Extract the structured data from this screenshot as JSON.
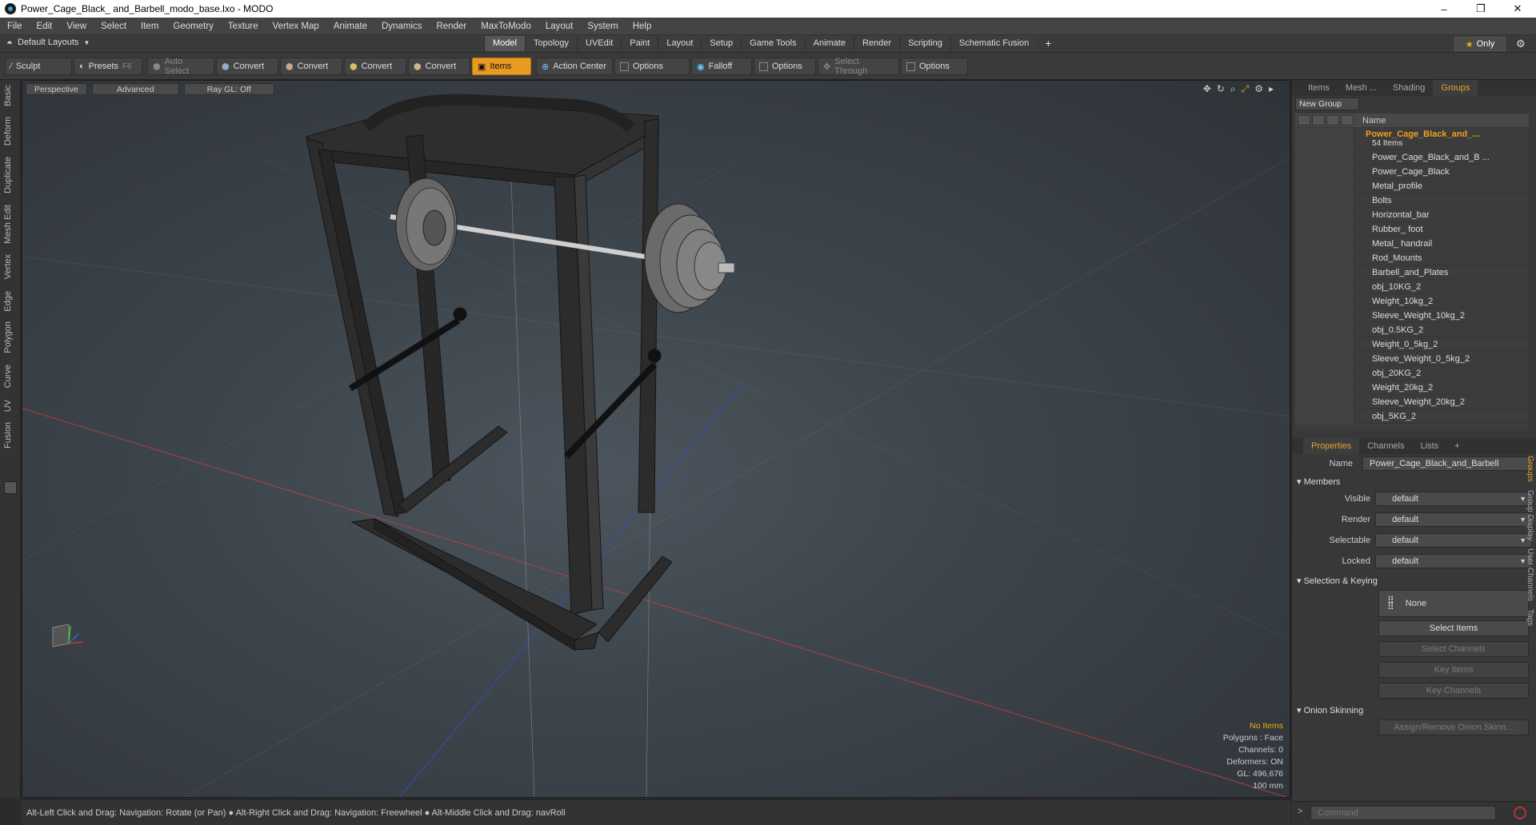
{
  "window": {
    "title": "Power_Cage_Black_ and_Barbell_modo_base.lxo - MODO",
    "min": "–",
    "restore": "❐",
    "close": "✕"
  },
  "menu": [
    "File",
    "Edit",
    "View",
    "Select",
    "Item",
    "Geometry",
    "Texture",
    "Vertex Map",
    "Animate",
    "Dynamics",
    "Render",
    "MaxToModo",
    "Layout",
    "System",
    "Help"
  ],
  "layoutbar": {
    "layout_label": "Default Layouts",
    "tabs": [
      "Model",
      "Topology",
      "UVEdit",
      "Paint",
      "Layout",
      "Setup",
      "Game Tools",
      "Animate",
      "Render",
      "Scripting",
      "Schematic Fusion"
    ],
    "active_tab": "Model",
    "add": "+",
    "only_label": "Only"
  },
  "toolbar": {
    "sculpt": "Sculpt",
    "presets": "Presets",
    "presets_key": "F6",
    "auto_select": "Auto Select",
    "convert1": "Convert",
    "convert2": "Convert",
    "convert3": "Convert",
    "convert4": "Convert",
    "items": "Items",
    "action_center": "Action Center",
    "options1": "Options",
    "falloff": "Falloff",
    "options2": "Options",
    "select_through": "Select Through",
    "options3": "Options"
  },
  "left_tabs": [
    "Basic",
    "Deform",
    "Duplicate",
    "Mesh Edit",
    "Vertex",
    "Edge",
    "Polygon",
    "Curve",
    "UV",
    "Fusion"
  ],
  "viewport": {
    "view": "Perspective",
    "mode": "Advanced",
    "raygl": "Ray GL: Off",
    "stats": {
      "no_items": "No Items",
      "polygons": "Polygons : Face",
      "channels": "Channels: 0",
      "deformers": "Deformers: ON",
      "gl": "GL: 496,676",
      "scale": "100 mm"
    }
  },
  "status": "Alt-Left Click and Drag: Navigation: Rotate (or Pan) ● Alt-Right Click and Drag: Navigation: Freewheel ● Alt-Middle Click and Drag: navRoll",
  "panel_top": {
    "tabs": [
      "Items",
      "Mesh ...",
      "Shading",
      "Groups"
    ],
    "active": "Groups",
    "new_group": "New Group",
    "name_col": "Name",
    "root": "Power_Cage_Black_and_...",
    "root_count": "54 Items",
    "items": [
      "Power_Cage_Black_and_B ...",
      "Power_Cage_Black",
      "Metal_profile",
      "Bolts",
      "Horizontal_bar",
      "Rubber_ foot",
      "Metal_ handrail",
      "Rod_Mounts",
      "Barbell_and_Plates",
      "obj_10KG_2",
      "Weight_10kg_2",
      "Sleeve_Weight_10kg_2",
      "obj_0.5KG_2",
      "Weight_0_5kg_2",
      "Sleeve_Weight_0_5kg_2",
      "obj_20KG_2",
      "Weight_20kg_2",
      "Sleeve_Weight_20kg_2",
      "obj_5KG_2"
    ]
  },
  "panel_props": {
    "tabs": [
      "Properties",
      "Channels",
      "Lists"
    ],
    "active": "Properties",
    "add": "+",
    "name_label": "Name",
    "name_value": "Power_Cage_Black_and_Barbell",
    "members": "Members",
    "visible_label": "Visible",
    "visible_value": "default",
    "render_label": "Render",
    "render_value": "default",
    "selectable_label": "Selectable",
    "selectable_value": "default",
    "locked_label": "Locked",
    "locked_value": "default",
    "selkey": "Selection & Keying",
    "none": "None",
    "select_items": "Select Items",
    "select_channels": "Select Channels",
    "key_items": "Key Items",
    "key_channels": "Key Channels",
    "onion": "Onion Skinning",
    "assign_onion": "Assign/Remove Onion Skinn...",
    "vtabs": [
      "Groups",
      "Group Display",
      "User Channels",
      "Tags"
    ]
  },
  "command": {
    "prompt": ">",
    "placeholder": "Command"
  }
}
